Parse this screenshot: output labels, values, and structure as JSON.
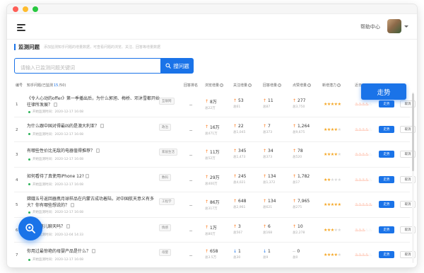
{
  "header": {
    "help_label": "帮助中心"
  },
  "section": {
    "title": "监测问题",
    "description": "添加监测知乎问题的增量数据，可查看问题的浏览、关注、回答等增量数据"
  },
  "search": {
    "placeholder": "请输入已监测问题关键词",
    "button_label": "搜问题"
  },
  "table": {
    "headers": {
      "index": "编号",
      "question_prefix": "知乎问题(已监测",
      "question_count": "15",
      "question_suffix": "/50)",
      "rank": "回答排名",
      "views": "浏览增量",
      "follows": "关注增量",
      "answers": "回答增量",
      "likes": "点赞增量",
      "potential": "新增潜力",
      "hot": "近日"
    },
    "rows": [
      {
        "index": "1",
        "title": "《令人心动的offer》第一季播出后，为什么郭旭、梅桥、邓沐雪都开始往律所发展？",
        "tag": "互联网",
        "meta": "开始监测时间：2020-12-17 16:08",
        "rank": "--",
        "views": "8万",
        "views_sum": "总22万",
        "views_dir": "up",
        "follows": "53",
        "follows_sum": "总61",
        "follows_dir": "up",
        "answers": "11",
        "answers_sum": "总87",
        "answers_dir": "up",
        "likes": "277",
        "likes_sum": "总3,750",
        "likes_dir": "up",
        "stars": 5,
        "flames": 4
      },
      {
        "index": "2",
        "title": "为什么跟中国对得最凶的是澳大利亚？",
        "tag": "政治",
        "meta": "开始监测时间：2020-12-17 16:08",
        "rank": "--",
        "views": "16万",
        "views_sum": "总471万",
        "views_dir": "up",
        "follows": "22",
        "follows_sum": "总1,045",
        "follows_dir": "up",
        "answers": "7",
        "answers_sum": "总373",
        "answers_dir": "up",
        "likes": "1,264",
        "likes_sum": "总9,675",
        "likes_dir": "up",
        "stars": 4,
        "flames": 4
      },
      {
        "index": "3",
        "title": "有哪些性价比无敌的电器值得推荐？",
        "tag": "家居生活",
        "meta": "开始监测时间：2020-12-17 16:08",
        "rank": "--",
        "views": "11万",
        "views_sum": "总52万",
        "views_dir": "up",
        "follows": "345",
        "follows_sum": "总1,473",
        "follows_dir": "up",
        "answers": "34",
        "answers_sum": "总373",
        "answers_dir": "up",
        "likes": "78",
        "likes_sum": "总520",
        "likes_dir": "up",
        "stars": 4,
        "flames": 4
      },
      {
        "index": "4",
        "title": "如何看待了真使用iPhone 12?",
        "tag": "数码",
        "meta": "开始监测时间：2020-12-17 16:08",
        "rank": "--",
        "views": "29万",
        "views_sum": "总400万",
        "views_dir": "up",
        "follows": "245",
        "follows_sum": "总4,021",
        "follows_dir": "up",
        "answers": "134",
        "answers_sum": "总1,372",
        "answers_dir": "up",
        "likes": "1,782",
        "likes_sum": "总17",
        "likes_dir": "up",
        "stars": 2,
        "flames": 4
      },
      {
        "index": "5",
        "title": "嫦娥五号返回器携月球样品在内蒙古成功着陆，对中国航天意义有多大？你有哪些想说的？",
        "tag": "工程学",
        "meta": "开始监测时间：2020-12-17 16:08",
        "rank": "--",
        "views": "86万",
        "views_sum": "总317万",
        "views_dir": "up",
        "follows": "648",
        "follows_sum": "总2,961",
        "follows_dir": "up",
        "answers": "134",
        "answers_sum": "总621",
        "answers_dir": "up",
        "likes": "7,965",
        "likes_sum": "总275",
        "likes_dir": "up",
        "stars": 5,
        "flames": 5
      },
      {
        "index": "6",
        "title": "么要跟婆儿聊天吗？",
        "tag": "情感",
        "meta": "开始监测时间：2020-12-04 14:33",
        "rank": "--",
        "views": "1万",
        "views_sum": "总80万",
        "views_dir": "up",
        "follows": "3",
        "follows_sum": "总567",
        "follows_dir": "up",
        "answers": "6",
        "answers_sum": "总168",
        "answers_dir": "up",
        "likes": "10",
        "likes_sum": "总2,278",
        "likes_dir": "up",
        "stars": 3,
        "flames": 3
      },
      {
        "index": "7",
        "title": "你用过最惊艳的母婴产品是什么？",
        "tag": "母婴",
        "meta": "开始监测时间：2020-12-17 16:08",
        "rank": "--",
        "views": "658",
        "views_sum": "总3.5万",
        "views_dir": "up",
        "follows": "1",
        "follows_sum": "总30",
        "follows_dir": "down",
        "answers": "1",
        "answers_sum": "总9",
        "answers_dir": "down",
        "likes": "0",
        "likes_sum": "总0",
        "likes_dir": "flat",
        "stars": 4,
        "flames": 4
      }
    ],
    "trend_label": "走势",
    "cancel_label": "取消"
  },
  "tooltip": {
    "label": "走势"
  },
  "colors": {
    "accent": "#1a73e8",
    "up": "#ff7a1a",
    "star": "#f5a623",
    "flame": "#ff5722"
  }
}
